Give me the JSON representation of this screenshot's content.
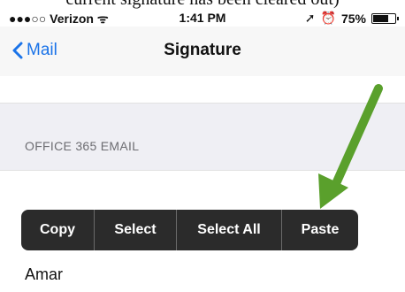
{
  "caption": "current signature has been cleared out)",
  "status_bar": {
    "carrier": "●●●○○ Verizon",
    "time": "1:41 PM",
    "battery_percent": "75%",
    "battery_level": 0.75
  },
  "nav": {
    "back_label": "Mail",
    "title": "Signature"
  },
  "section": {
    "header": "OFFICE 365 EMAIL"
  },
  "edit_menu": {
    "items": [
      "Copy",
      "Select",
      "Select All",
      "Paste"
    ]
  },
  "signature": {
    "text": "Amar"
  },
  "colors": {
    "accent": "#1a73e8",
    "arrow": "#5aa02c",
    "menu_bg": "#2b2b2b"
  }
}
